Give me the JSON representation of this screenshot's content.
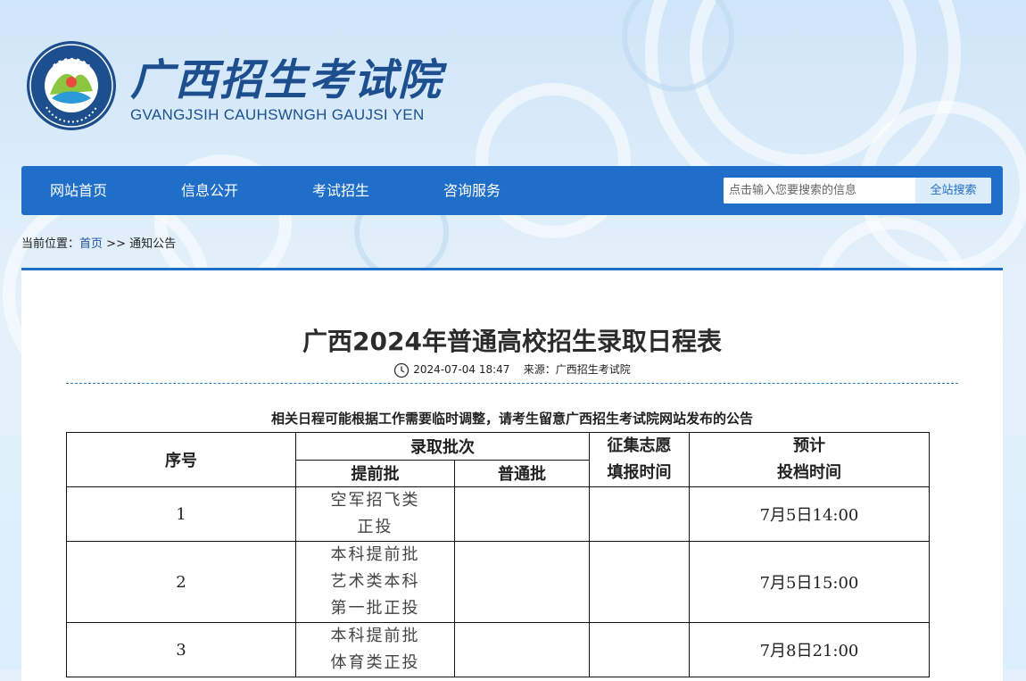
{
  "site": {
    "name_cn": "广西招生考试院",
    "name_en": "GVANGJSIH CAUHSWNGH GAUJSI YEN",
    "emblem_ring_text": "广西招生考试院",
    "emblem_ring_text_en": "GVANGJSIH CAUHSWNGH GAUJSI YEN"
  },
  "nav": {
    "items": [
      {
        "label": "网站首页"
      },
      {
        "label": "信息公开"
      },
      {
        "label": "考试招生"
      },
      {
        "label": "咨询服务"
      }
    ],
    "search_placeholder": "点击输入您要搜索的信息",
    "search_button": "全站搜索"
  },
  "breadcrumb": {
    "prefix": "当前位置：",
    "home": "首页",
    "separator": ">>",
    "current": "通知公告"
  },
  "article": {
    "title": "广西2024年普通高校招生录取日程表",
    "datetime": "2024-07-04 18:47",
    "source": "来源：广西招生考试院",
    "notice": "相关日程可能根据工作需要临时调整，请考生留意广西招生考试院网站发布的公告"
  },
  "table": {
    "headers": {
      "index": "序号",
      "batch": "录取批次",
      "early": "提前批",
      "regular": "普通批",
      "solicit_line1": "征集志愿",
      "solicit_line2": "填报时间",
      "expected_line1": "预计",
      "expected_line2": "投档时间"
    },
    "rows": [
      {
        "index": "1",
        "early": [
          "空军招飞类",
          "正投"
        ],
        "regular": "",
        "solicit": "",
        "time": "7月5日14:00"
      },
      {
        "index": "2",
        "early": [
          "本科提前批",
          "艺术类本科",
          "第一批正投"
        ],
        "regular": "",
        "solicit": "",
        "time": "7月5日15:00"
      },
      {
        "index": "3",
        "early": [
          "本科提前批",
          "体育类正投"
        ],
        "regular": "",
        "solicit": "",
        "time": "7月8日21:00"
      }
    ]
  },
  "colors": {
    "primary_blue": "#1f6ec8",
    "title_blue": "#1d4f8e",
    "background": "#e3f0fb"
  }
}
